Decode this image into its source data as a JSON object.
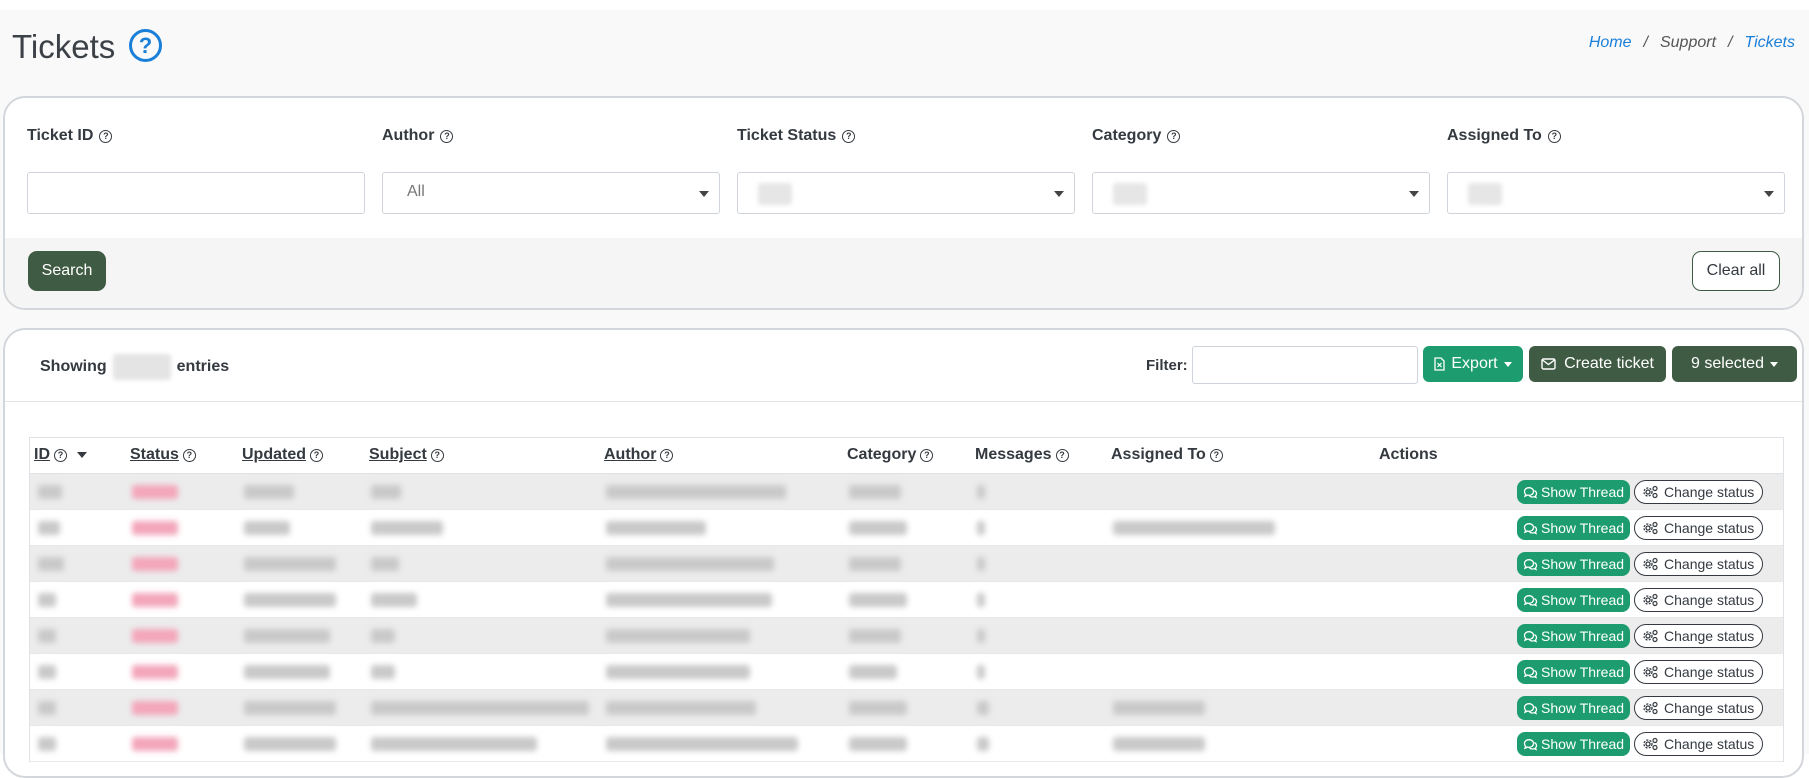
{
  "header": {
    "title": "Tickets",
    "help_glyph": "?",
    "breadcrumb": {
      "home": "Home",
      "support": "Support",
      "current": "Tickets",
      "separator": "/"
    }
  },
  "filters": {
    "ticket_id": {
      "label": "Ticket ID",
      "value": ""
    },
    "author": {
      "label": "Author",
      "value": "All"
    },
    "ticket_status": {
      "label": "Ticket Status"
    },
    "category": {
      "label": "Category"
    },
    "assigned_to": {
      "label": "Assigned To"
    },
    "help_glyph": "?",
    "search_label": "Search",
    "clear_label": "Clear all"
  },
  "toolbar": {
    "showing_prefix": "Showing",
    "showing_suffix": "entries",
    "filter_label": "Filter:",
    "filter_value": "",
    "export_label": "Export",
    "create_label": "Create ticket",
    "selected_label": "9 selected"
  },
  "table": {
    "columns": {
      "id": "ID",
      "status": "Status",
      "updated": "Updated",
      "subject": "Subject",
      "author": "Author",
      "category": "Category",
      "messages": "Messages",
      "assigned_to": "Assigned To",
      "actions": "Actions"
    },
    "row_actions": {
      "show_thread": "Show Thread",
      "change_status": "Change status"
    },
    "row_count": 8
  },
  "colors": {
    "primary_dark": "#3f5b43",
    "success_green": "#1d9d6f",
    "link_blue": "#1a7fd8",
    "status_pink": "#f3a6bb"
  },
  "icons": {
    "title_help": "question-circle-icon",
    "label_help": "question-circle-icon",
    "export": "file-excel-icon",
    "create": "envelope-icon",
    "show_thread": "comments-icon",
    "change_status": "gears-icon"
  }
}
